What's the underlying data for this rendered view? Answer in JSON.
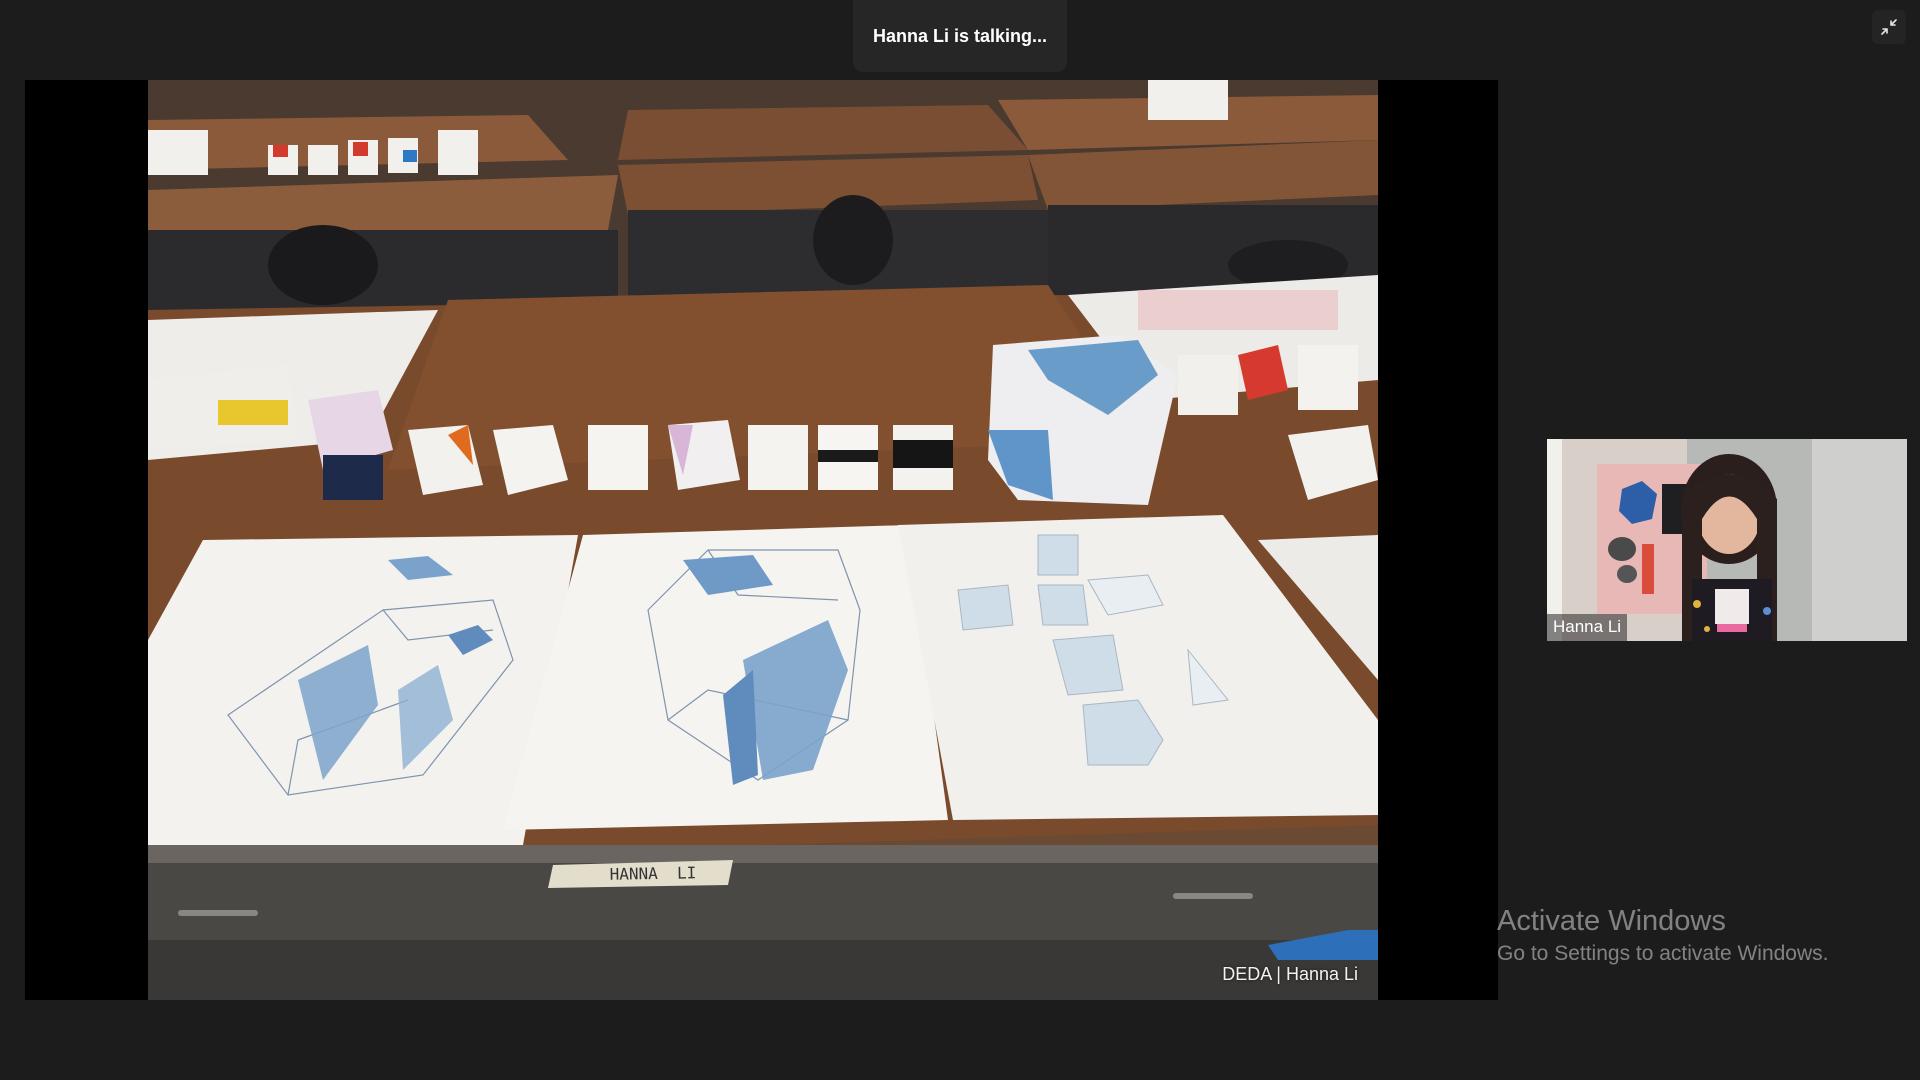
{
  "banner": {
    "talking_text": "Hanna Li is talking..."
  },
  "controls": {
    "minimize_icon": "exit-fullscreen-icon"
  },
  "share": {
    "caption": "DEDA | Hanna Li",
    "desk_label": "HANNA  LI"
  },
  "participant": {
    "name": "Hanna Li"
  },
  "watermark": {
    "title": "Activate Windows",
    "subtitle": "Go to Settings to activate Windows."
  },
  "colors": {
    "background": "#1c1c1c",
    "banner": "#262626",
    "desk": "#7a4a2c",
    "drawing_blue": "#5b86b3"
  }
}
